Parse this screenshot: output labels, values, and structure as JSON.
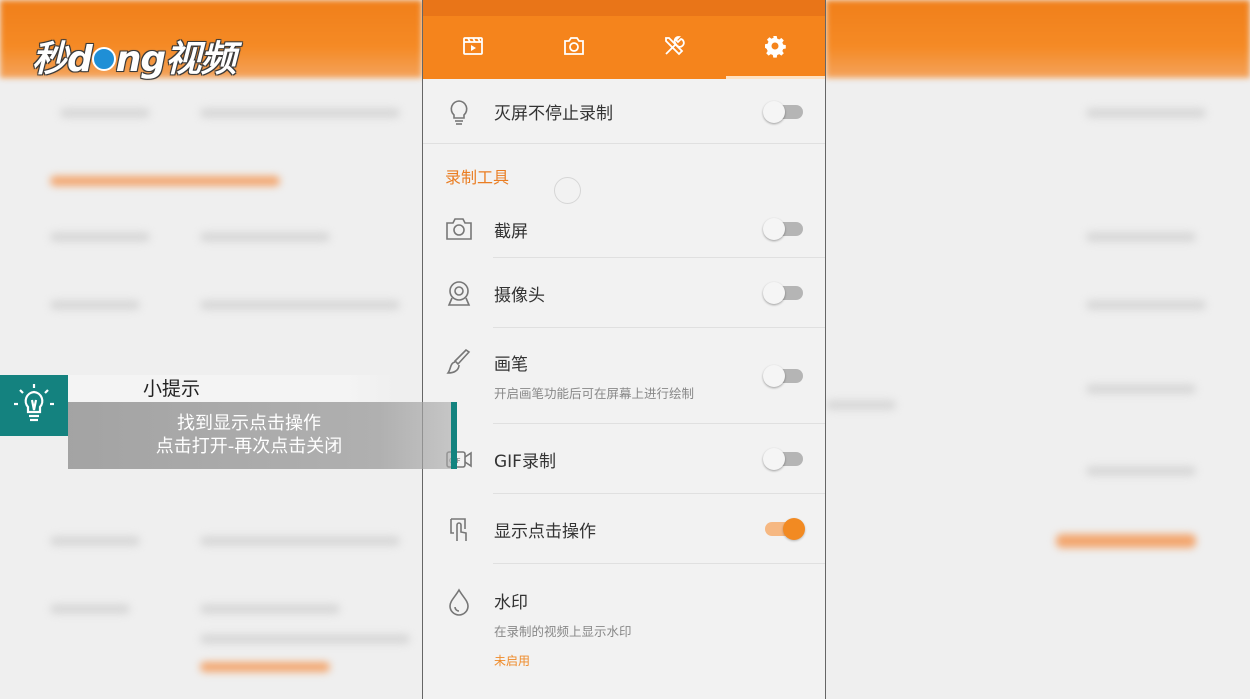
{
  "watermark": {
    "logo_text_left": "秒",
    "logo_text_mid": "d",
    "logo_text_right": "ng视频"
  },
  "tabs": [
    {
      "icon": "video-clip-icon"
    },
    {
      "icon": "camera-icon"
    },
    {
      "icon": "tools-icon"
    },
    {
      "icon": "gear-icon",
      "active": true
    }
  ],
  "settings": {
    "screen_off": {
      "label": "灭屏不停止录制",
      "enabled": false
    },
    "section_title": "录制工具",
    "screenshot": {
      "label": "截屏",
      "enabled": false
    },
    "camera": {
      "label": "摄像头",
      "enabled": false
    },
    "brush": {
      "label": "画笔",
      "description": "开启画笔功能后可在屏幕上进行绘制",
      "enabled": false
    },
    "gif": {
      "label": "GIF录制",
      "enabled": false
    },
    "show_touches": {
      "label": "显示点击操作",
      "enabled": true
    },
    "watermark": {
      "label": "水印",
      "description": "在录制的视频上显示水印",
      "status": "未启用"
    }
  },
  "tip": {
    "title": "小提示",
    "line1": "找到显示点击操作",
    "line2": "点击打开-再次点击关闭"
  },
  "colors": {
    "accent": "#f5841c",
    "tip_teal": "#14827f"
  }
}
